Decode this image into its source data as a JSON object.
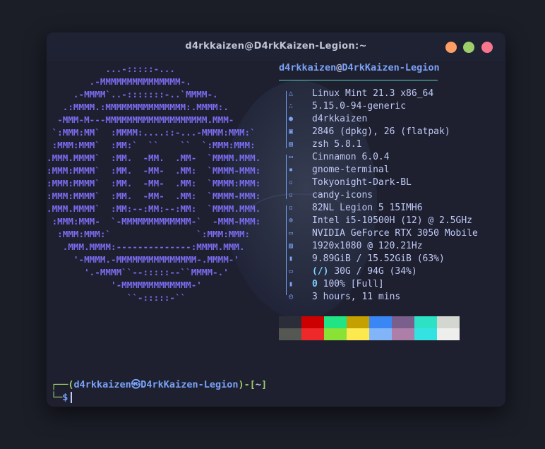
{
  "window": {
    "title": "d4rkkaizen@D4rkKaizen-Legion:~",
    "buttons": {
      "minimize_color": "#ff9e64",
      "maximize_color": "#9ece6a",
      "close_color": "#f7768e"
    }
  },
  "ascii_art": [
    "           ...-:::::-...",
    "        .-MMMMMMMMMMMMMMM-.",
    "     .-MMMM`..-:::::::-..`MMMM-.",
    "   .:MMMM.:MMMMMMMMMMMMMMM:.MMMM:.",
    "  -MMM-M---MMMMMMMMMMMMMMMMMMM.MMM-",
    " `:MMM:MM`  :MMMM:....::-...-MMMM:MMM:`",
    " :MMM:MMM`  :MM:`  ``    ``  `:MMM:MMM:",
    ".MMM.MMMM`  :MM.  -MM.  .MM-  `MMMM.MMM.",
    ":MMM:MMMM`  :MM.  -MM-  .MM:  `MMMM-MMM:",
    ":MMM:MMMM`  :MM.  -MM-  .MM:  `MMMM:MMM:",
    ":MMM:MMMM`  :MM.  -MM-  .MM:  `MMMM-MMM:",
    ".MMM.MMMM`  :MM:--:MM:--:MM:  `MMMM.MMM.",
    " :MMM:MMM-  `-MMMMMMMMMMMMM-`  -MMM-MMM:",
    "  :MMM:MMM:`                `:MMM:MMM:",
    "   .MMM.MMMM:--------------:MMMM.MMM.",
    "     '-MMMM.-MMMMMMMMMMMMMMM-.MMMM-'",
    "       '.-MMMM``--:::::--``MMMM-.'",
    "            '-MMMMMMMMMMMMM-'",
    "               ``-:::::-``"
  ],
  "info": {
    "user": "d4rkkaizen",
    "at": "@",
    "host": "D4rkKaizen-Legion",
    "rows": [
      {
        "icon": "distro-icon",
        "glyph": "△",
        "text": "Linux Mint 21.3 x86_64"
      },
      {
        "icon": "kernel-icon",
        "glyph": "∴",
        "text": "5.15.0-94-generic"
      },
      {
        "icon": "user-icon",
        "glyph": "●",
        "text": "d4rkkaizen"
      },
      {
        "icon": "package-icon",
        "glyph": "▣",
        "text": "2846 (dpkg), 26 (flatpak)"
      },
      {
        "icon": "shell-icon",
        "glyph": "▤",
        "text": "zsh 5.8.1"
      },
      {
        "icon": "de-icon",
        "glyph": "▭",
        "text": "Cinnamon 6.0.4"
      },
      {
        "icon": "terminal-icon",
        "glyph": "▪",
        "text": "gnome-terminal"
      },
      {
        "icon": "theme-icon",
        "glyph": "▫",
        "text": "Tokyonight-Dark-BL"
      },
      {
        "icon": "icons-icon",
        "glyph": "▫",
        "text": "candy-icons"
      },
      {
        "icon": "host-icon",
        "glyph": "▫",
        "text": "82NL Legion 5 15IMH6"
      },
      {
        "icon": "cpu-icon",
        "glyph": "⊕",
        "text": "Intel i5-10500H (12) @ 2.5GHz"
      },
      {
        "icon": "gpu-icon",
        "glyph": "▭",
        "text": "NVIDIA GeForce RTX 3050 Mobile"
      },
      {
        "icon": "resolution-icon",
        "glyph": "▨",
        "text": "1920x1080 @ 120.21Hz"
      },
      {
        "icon": "memory-icon",
        "glyph": "▮",
        "text": "9.89GiB / 15.52GiB (63%)"
      },
      {
        "icon": "disk-icon",
        "glyph": "▭",
        "text": "30G / 94G (34%)",
        "prefix": "(/)"
      },
      {
        "icon": "battery-icon",
        "glyph": "▮",
        "text": "100% [Full]",
        "prefix": "0"
      },
      {
        "icon": "uptime-icon",
        "glyph": "◴",
        "text": "3 hours, 11 mins"
      }
    ]
  },
  "palette": {
    "top": [
      "#2b2e39",
      "#cc0000",
      "#21e584",
      "#c4a000",
      "#3a86f5",
      "#7a5f8c",
      "#2de2c4",
      "#d3d7cf"
    ],
    "bottom": [
      "#555753",
      "#ef2929",
      "#8ae234",
      "#fce94f",
      "#82b5f7",
      "#ad7fa8",
      "#34e2e2",
      "#eeeeec"
    ]
  },
  "prompt": {
    "corner_top": "┌──(",
    "user": "d4rkkaizen",
    "symbol": "㉿",
    "host": "D4rkKaizen-Legion",
    "mid": ")-[",
    "path": "~",
    "end": "]",
    "corner_bottom": "└─",
    "dollar": "$"
  }
}
